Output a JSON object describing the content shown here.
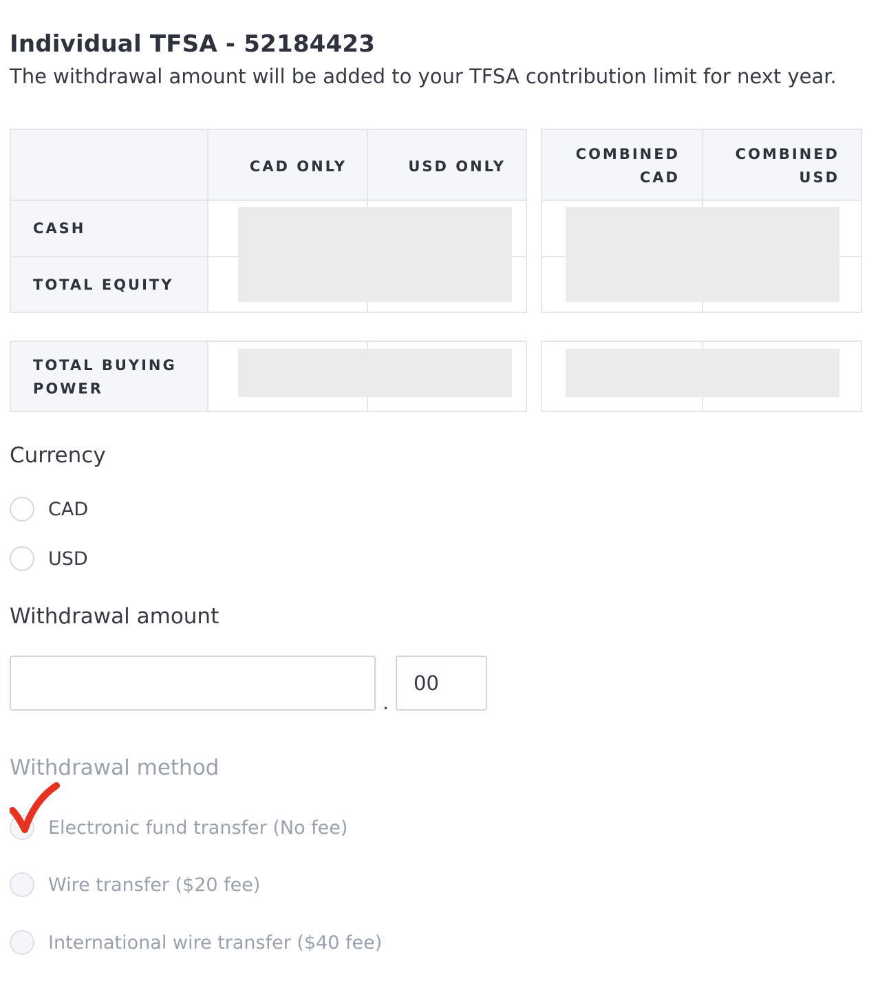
{
  "account": {
    "title": "Individual TFSA - 52184423",
    "subtitle": "The withdrawal amount will be added to your TFSA contribution limit for next year."
  },
  "balances": {
    "headers": {
      "cad_only": "CAD ONLY",
      "usd_only": "USD ONLY",
      "combined_cad": "COMBINED CAD",
      "combined_usd": "COMBINED USD"
    },
    "rows": {
      "cash": "CASH",
      "total_equity": "TOTAL EQUITY",
      "total_buying_power": "TOTAL BUYING POWER"
    }
  },
  "currency": {
    "heading": "Currency",
    "options": [
      {
        "label": "CAD",
        "selected": false
      },
      {
        "label": "USD",
        "selected": false
      }
    ]
  },
  "withdrawal_amount": {
    "heading": "Withdrawal amount",
    "dollars_value": "",
    "separator": ".",
    "cents_value": "00"
  },
  "withdrawal_method": {
    "heading": "Withdrawal method",
    "options": [
      {
        "label": "Electronic fund transfer (No fee)",
        "disabled": true
      },
      {
        "label": "Wire transfer ($20 fee)",
        "disabled": true
      },
      {
        "label": "International wire transfer ($40 fee)",
        "disabled": true
      }
    ],
    "annotation": {
      "icon": "checkmark-icon",
      "color": "#e8321e"
    }
  },
  "colors": {
    "border": "#e3e7ec",
    "header_bg": "#f4f6f9",
    "redaction": "#ebebeb",
    "muted_text": "#9aa1ae"
  }
}
